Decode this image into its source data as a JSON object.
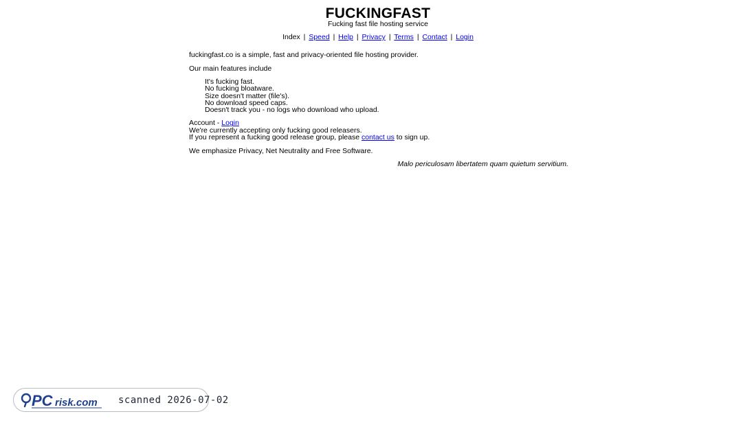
{
  "header": {
    "title": "FUCKINGFAST",
    "tagline": "Fucking fast file hosting service"
  },
  "nav": {
    "index": "Index",
    "speed": "Speed",
    "help": "Help",
    "privacy": "Privacy",
    "terms": "Terms",
    "contact": "Contact",
    "login": "Login",
    "separator": "|"
  },
  "main": {
    "intro": "fuckingfast.co is a simple, fast and privacy-oriented file hosting provider.",
    "features_heading": "Our main features include",
    "features": [
      "It's fucking fast.",
      "No fucking bloatware.",
      "Size doesn't matter (file's).",
      "No download speed caps.",
      "Doesn't track you - no logs who download who upload."
    ],
    "account_prefix": "Account - ",
    "account_link": "Login",
    "releasers_line": "We're currently accepting only fucking good releasers.",
    "represent_prefix": "If you represent a fucking good release group, please ",
    "contact_link": "contact us",
    "represent_suffix": " to sign up.",
    "emphasize": "We emphasize Privacy, Net Neutrality and Free Software.",
    "motto": "Malo periculosam libertatem quam quietum servitium."
  },
  "watermark": {
    "logo_text": "PCrisk.com",
    "scan_text": "scanned 2026-07-02",
    "logo_color": "#1f3f8f"
  }
}
